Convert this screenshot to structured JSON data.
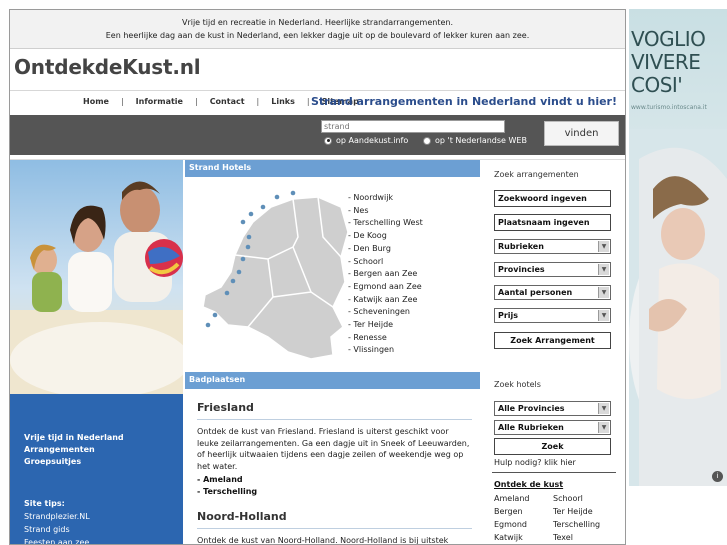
{
  "top": {
    "line1": "Vrije tijd en recreatie in Nederland. Heerlijke strandarrangementen.",
    "line2": "Een heerlijke dag aan de kust in Nederland, een lekker dagje uit op de boulevard of lekker kuren aan zee."
  },
  "logo": "OntdekdeKust.nl",
  "nav": {
    "items": [
      "Home",
      "Informatie",
      "Contact",
      "Links",
      "Sitemap"
    ],
    "separator": "|",
    "slogan": "Strand arrangementen in Nederland vindt u hier!"
  },
  "search": {
    "placeholder": "strand",
    "option1": "op Aandekust.info",
    "option2": "op 't Nederlandse WEB",
    "button": "vinden"
  },
  "left": {
    "nav": [
      "Vrije tijd in Nederland",
      "Arrangementen",
      "Groepsuitjes"
    ],
    "tips_title": "Site tips:",
    "tips": [
      "Strandplezier.NL",
      "Strand gids",
      "Feesten aan zee"
    ]
  },
  "middle": {
    "hotels_title": "Strand Hotels",
    "places": [
      "- Noordwijk",
      "- Nes",
      "- Terschelling West",
      "- De Koog",
      "- Den Burg",
      "- Schoorl",
      "- Bergen aan Zee",
      "- Egmond aan Zee",
      "- Katwijk aan Zee",
      "- Scheveningen",
      "- Ter Heijde",
      "- Renesse",
      "- Vlissingen"
    ],
    "badplaatsen_title": "Badplaatsen",
    "regions": [
      {
        "title": "Friesland",
        "text": "Ontdek de kust van Friesland. Friesland is uiterst geschikt voor leuke zeilarrangementen. Ga een dagje uit in Sneek of Leeuwarden, of heerlijk uitwaaien tijdens een dagje zeilen of weekendje weg op het water.",
        "links": [
          "- Ameland",
          "- Terschelling"
        ]
      },
      {
        "title": "Noord-Holland",
        "text": "Ontdek de kust van Noord-Holland. Noord-Holland is bij uitstek"
      }
    ]
  },
  "right": {
    "zoek_arr_title": "Zoek arrangementen",
    "keyword_btn": "Zoekwoord ingeven",
    "place_btn": "Plaatsnaam ingeven",
    "selects": [
      "Rubrieken",
      "Provincies",
      "Aantal personen",
      "Prijs"
    ],
    "zoek_arr_btn": "Zoek Arrangement",
    "zoek_hotels_title": "Zoek hotels",
    "hotel_selects": [
      "Alle Provincies",
      "Alle Rubrieken"
    ],
    "zoek_btn": "Zoek",
    "help": "Hulp nodig? klik hier",
    "ontdek_title": "Ontdek de kust",
    "ontdek": [
      "Ameland",
      "Schoorl",
      "Bergen",
      "Ter Heijde",
      "Egmond",
      "Terschelling",
      "Katwijk",
      "Texel"
    ]
  },
  "ad": {
    "text": "VOGLIO VIVERE COSI'",
    "url": "www.turismo.intoscana.it",
    "info_icon": "i"
  }
}
